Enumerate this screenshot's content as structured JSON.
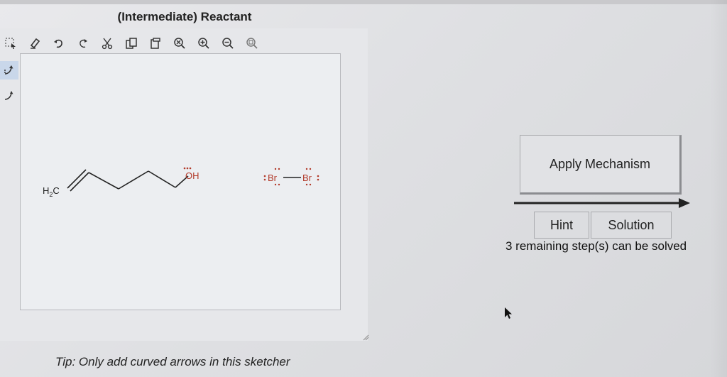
{
  "sketcher": {
    "title": "(Intermediate) Reactant",
    "toolbar": [
      {
        "name": "select-icon"
      },
      {
        "name": "eraser-icon"
      },
      {
        "name": "undo-icon"
      },
      {
        "name": "redo-icon"
      },
      {
        "name": "cut-icon"
      },
      {
        "name": "copy-icon"
      },
      {
        "name": "paste-icon"
      },
      {
        "name": "zoom-reset-icon"
      },
      {
        "name": "zoom-in-icon"
      },
      {
        "name": "zoom-out-icon"
      },
      {
        "name": "zoom-fit-icon"
      }
    ],
    "side_tools": [
      {
        "name": "curved-arrow-two-electron-icon",
        "active": true
      },
      {
        "name": "curved-arrow-single-electron-icon",
        "active": false
      }
    ],
    "molecules": {
      "alkene_end": "H",
      "alkene_sub": "2",
      "alkene_c": "C",
      "alcohol": "OH",
      "bromine_left": "Br",
      "bromine_right": "Br"
    },
    "tip": "Tip: Only add curved arrows in this sketcher"
  },
  "actions": {
    "apply_label": "Apply Mechanism",
    "hint_label": "Hint",
    "solution_label": "Solution",
    "remaining_text": "3 remaining step(s) can be solved"
  },
  "colors": {
    "heteroatom": "#b23a2a",
    "bond": "#222222",
    "active_tool": "#c9d7ea"
  }
}
